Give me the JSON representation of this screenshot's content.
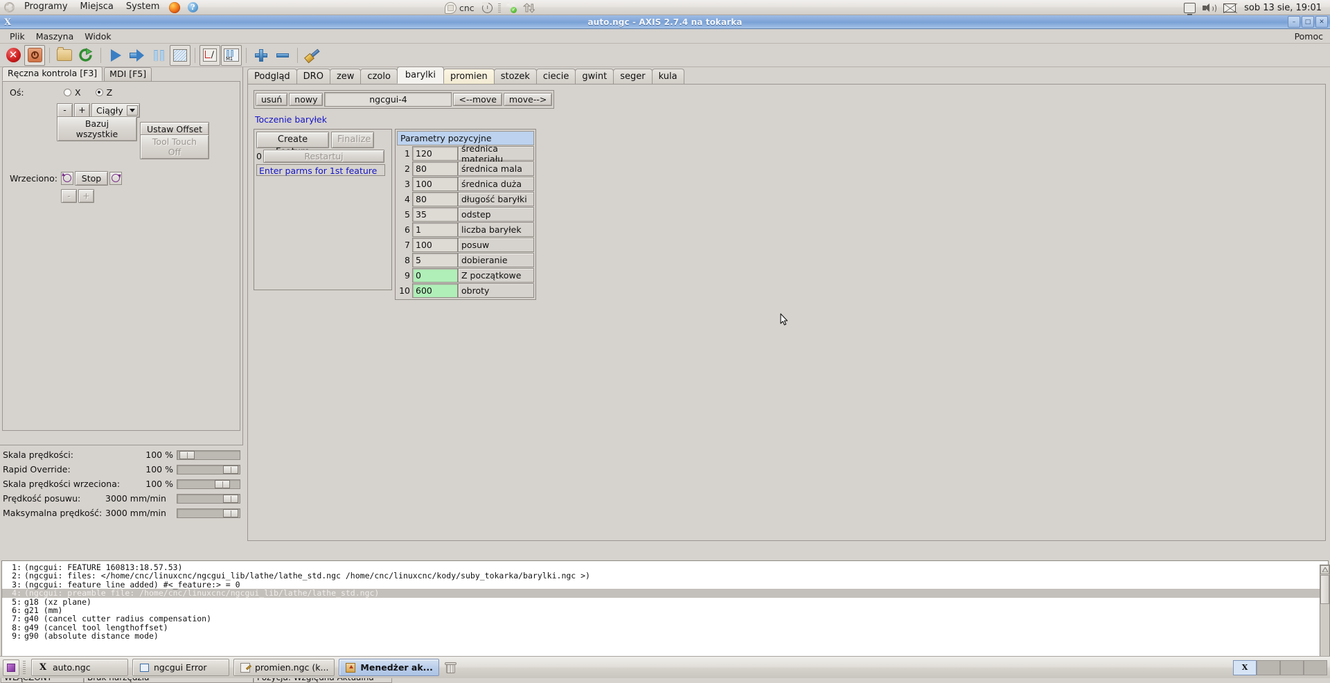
{
  "gnome_panel": {
    "menus": [
      "Programy",
      "Miejsca",
      "System"
    ],
    "icons": [
      "ubuntu-logo-icon",
      "firefox-icon",
      "help-icon"
    ],
    "help_glyph": "?",
    "tray": {
      "cnc_label": "cnc",
      "icons": [
        "cnc-bubble-icon",
        "power-icon",
        "dropbox-icon",
        "updown-arrows-icon"
      ]
    },
    "right_icons": [
      "monitor-icon",
      "volume-icon",
      "mail-icon"
    ],
    "clock": "sob 13 sie, 19:01"
  },
  "window": {
    "title": "auto.ngc - AXIS 2.7.4 na tokarka",
    "buttons": {
      "minimize": "–",
      "maximize": "□",
      "close": "✕"
    },
    "menubar": {
      "items": [
        "Plik",
        "Maszyna",
        "Widok"
      ],
      "help": "Pomoc"
    },
    "toolbar": [
      {
        "name": "estop-toggle-button",
        "icon": "emergency-stop-icon"
      },
      {
        "name": "machine-power-button",
        "icon": "power-icon"
      },
      {
        "name": "open-file-button",
        "icon": "folder-icon"
      },
      {
        "name": "reload-file-button",
        "icon": "reload-icon"
      },
      {
        "name": "run-program-button",
        "icon": "play-icon"
      },
      {
        "name": "step-program-button",
        "icon": "arrow-right-icon"
      },
      {
        "name": "pause-program-button",
        "icon": "pause-icon"
      },
      {
        "name": "stop-program-button",
        "icon": "stop-square-icon"
      },
      {
        "name": "toggle-skip-lines-button",
        "icon": "block-delete-icon"
      },
      {
        "name": "toggle-optional-stop-button",
        "icon": "m1-optional-stop-icon"
      },
      {
        "name": "zoom-in-button",
        "icon": "plus-icon"
      },
      {
        "name": "zoom-out-button",
        "icon": "minus-icon"
      },
      {
        "name": "clear-plot-button",
        "icon": "brush-icon"
      }
    ]
  },
  "left_panel": {
    "tabs": [
      {
        "label": "Ręczna kontrola [F3]",
        "active": true
      },
      {
        "label": "MDI [F5]",
        "active": false
      }
    ],
    "axis_label": "Oś:",
    "axes": [
      {
        "label": "X",
        "selected": false
      },
      {
        "label": "Z",
        "selected": true
      }
    ],
    "jog_minus": "-",
    "jog_plus": "+",
    "jog_mode": "Ciągły",
    "home_all_button": "Bazuj wszystkie",
    "set_offset_button": "Ustaw Offset",
    "tool_touch_off_button": "Tool Touch Off",
    "spindle_label": "Wrzeciono:",
    "spindle_stop_button": "Stop",
    "spindle_ccw": "spindle-ccw-icon",
    "spindle_cw": "spindle-cw-icon",
    "spindle_minus": "-",
    "spindle_plus": "+",
    "sliders": [
      {
        "name": "Skala prędkości:",
        "value": "100 %",
        "pos": 8
      },
      {
        "name": "Rapid Override:",
        "value": "100 %",
        "pos": 76
      },
      {
        "name": "Skala prędkości wrzeciona:",
        "value": "100 %",
        "pos": 67
      },
      {
        "name": "Prędkość posuwu:",
        "value": "3000 mm/min",
        "pos": 76
      },
      {
        "name": "Maksymalna prędkość:",
        "value": "3000 mm/min",
        "pos": 76
      }
    ]
  },
  "right_panel": {
    "tabs": [
      {
        "label": "Podgląd",
        "state": "normal"
      },
      {
        "label": "DRO",
        "state": "normal"
      },
      {
        "label": "zew",
        "state": "normal"
      },
      {
        "label": "czolo",
        "state": "normal"
      },
      {
        "label": "barylki",
        "state": "active"
      },
      {
        "label": "promien",
        "state": "hover"
      },
      {
        "label": "stozek",
        "state": "normal"
      },
      {
        "label": "ciecie",
        "state": "normal"
      },
      {
        "label": "gwint",
        "state": "normal"
      },
      {
        "label": "seger",
        "state": "normal"
      },
      {
        "label": "kula",
        "state": "normal"
      }
    ],
    "ngcgui": {
      "delete_button": "usuń",
      "new_button": "nowy",
      "tab_name_field": "ngcgui-4",
      "move_left_button": "<--move",
      "move_right_button": "move-->",
      "subroutine_title": "Toczenie baryłek",
      "create_feature_button": "Create Feature",
      "finalize_button": "Finalize",
      "feature_count": "0",
      "restart_button": "Restartuj",
      "status_message": "Enter parms for 1st feature",
      "params_header": "Parametry pozycyjne",
      "params": [
        {
          "num": "1",
          "value": "120",
          "desc": "średnica materiału",
          "highlight": false
        },
        {
          "num": "2",
          "value": "80",
          "desc": "średnica mala",
          "highlight": false
        },
        {
          "num": "3",
          "value": "100",
          "desc": "średnica duża",
          "highlight": false
        },
        {
          "num": "4",
          "value": "80",
          "desc": "długość baryłki",
          "highlight": false
        },
        {
          "num": "5",
          "value": "35",
          "desc": "odstep",
          "highlight": false
        },
        {
          "num": "6",
          "value": "1",
          "desc": "liczba baryłek",
          "highlight": false
        },
        {
          "num": "7",
          "value": "100",
          "desc": "posuw",
          "highlight": false
        },
        {
          "num": "8",
          "value": "5",
          "desc": "dobieranie",
          "highlight": false
        },
        {
          "num": "9",
          "value": "0",
          "desc": "Z początkowe",
          "highlight": true
        },
        {
          "num": "10",
          "value": "600",
          "desc": "obroty",
          "highlight": true
        }
      ]
    }
  },
  "log": {
    "lines": [
      {
        "n": "1:",
        "text": "(ngcgui: FEATURE 160813:18.57.53)",
        "selected": false
      },
      {
        "n": "2:",
        "text": "(ngcgui: files: </home/cnc/linuxcnc/ngcgui_lib/lathe/lathe_std.ngc /home/cnc/linuxcnc/kody/suby_tokarka/barylki.ngc >)",
        "selected": false
      },
      {
        "n": "3:",
        "text": "(ngcgui: feature line added) #<_feature:> = 0",
        "selected": false
      },
      {
        "n": "4:",
        "text": "(ngcgui: preamble file: /home/cnc/linuxcnc/ngcgui_lib/lathe/lathe_std.ngc)",
        "selected": true
      },
      {
        "n": "5:",
        "text": "g18 (xz plane)",
        "selected": false
      },
      {
        "n": "6:",
        "text": "g21 (mm)",
        "selected": false
      },
      {
        "n": "7:",
        "text": "g40 (cancel cutter radius compensation)",
        "selected": false
      },
      {
        "n": "8:",
        "text": "g49 (cancel tool lengthoffset)",
        "selected": false
      },
      {
        "n": "9:",
        "text": "g90 (absolute distance mode)",
        "selected": false
      }
    ]
  },
  "statusbar": [
    "WŁĄCZONY",
    "Brak narzędzia",
    "Pozycja: Względna Aktualna"
  ],
  "taskbar": {
    "buttons": [
      {
        "label": "auto.ngc",
        "icon": "x-window-icon",
        "active": false
      },
      {
        "label": "ngcgui Error",
        "icon": "window-icon",
        "active": false
      },
      {
        "label": "promien.ngc (k...",
        "icon": "editor-icon",
        "active": false
      },
      {
        "label": "Menedżer ak...",
        "icon": "archive-manager-icon",
        "active": true
      }
    ],
    "show_desktop": "show-desktop-icon",
    "trash": "trash-icon",
    "workspaces": 4,
    "current_workspace": 1
  },
  "colors": {
    "face": "#d6d2cd",
    "title_blue": "#84a8da",
    "link_blue": "#1414c8",
    "param_header": "#bcd2ee",
    "param_highlight": "#b0efb8",
    "accent_active_tab": "#f5f3ef"
  }
}
